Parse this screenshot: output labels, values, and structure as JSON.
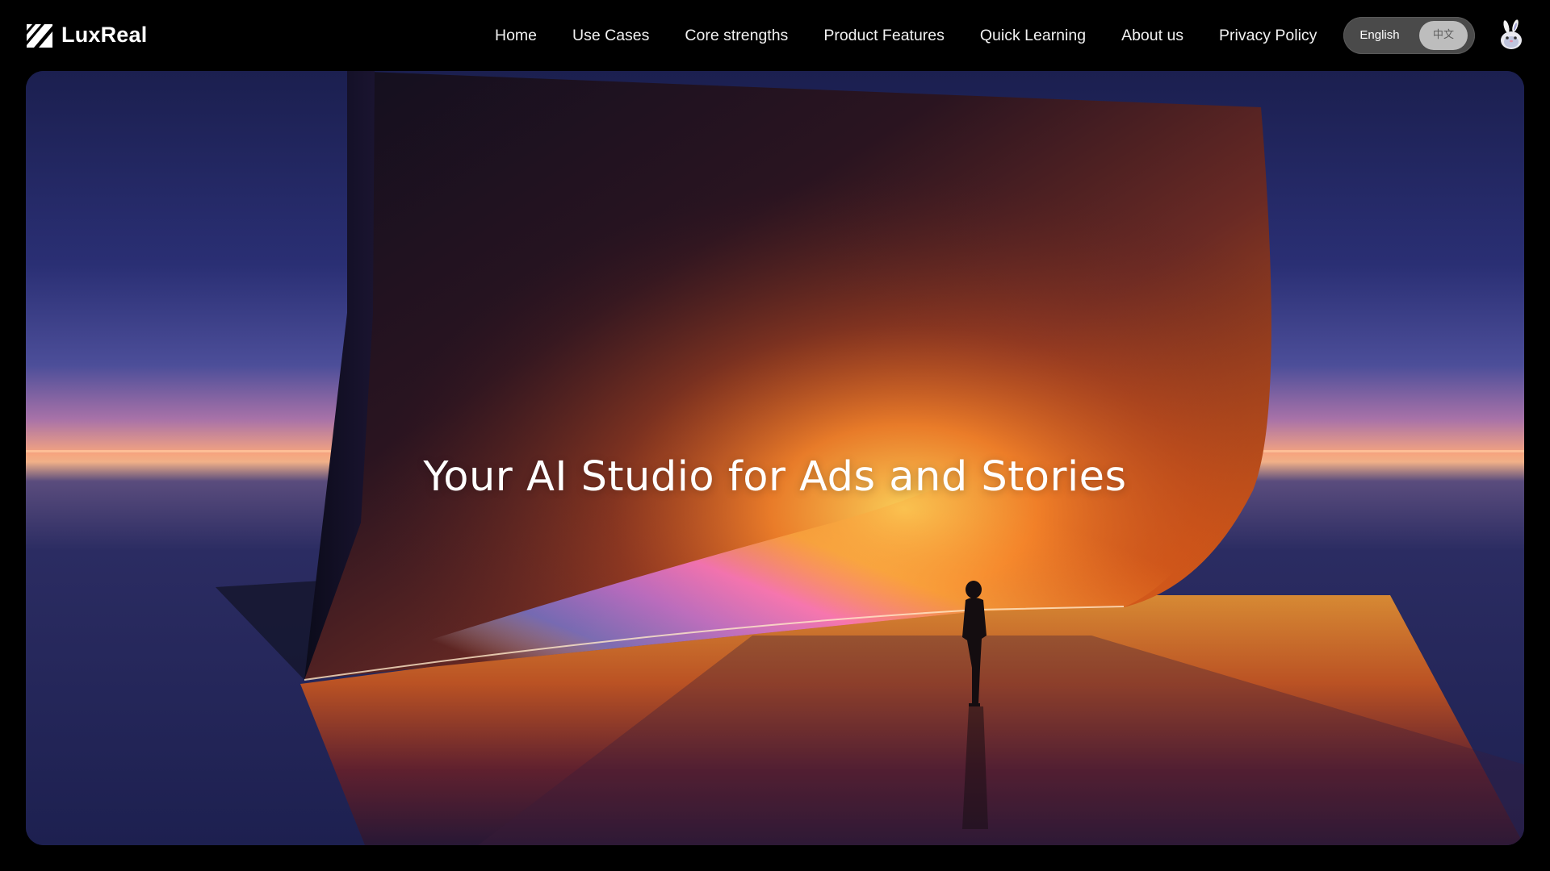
{
  "brand": {
    "name": "LuxReal",
    "logo_icon": "luxreal-logo-icon"
  },
  "nav": {
    "items": [
      {
        "label": "Home"
      },
      {
        "label": "Use Cases"
      },
      {
        "label": "Core strengths"
      },
      {
        "label": "Product Features"
      },
      {
        "label": "Quick Learning"
      },
      {
        "label": "About us"
      },
      {
        "label": "Privacy Policy"
      }
    ]
  },
  "language": {
    "options": [
      {
        "label": "English",
        "selected": true
      },
      {
        "label": "中文",
        "selected": false
      }
    ]
  },
  "user": {
    "avatar_icon": "rabbit-avatar-icon"
  },
  "hero": {
    "title": "Your AI Studio for Ads and Stories"
  },
  "colors": {
    "page_background": "#000000",
    "nav_text": "#f2f2f2",
    "toggle_track": "#4a4a4a",
    "toggle_inactive_pill": "#bdbdbd",
    "sky_top": "#1c2150",
    "horizon_glow": "#f3a07a",
    "wall_orange": "#e8701c",
    "wall_pink": "#f47ad6"
  }
}
